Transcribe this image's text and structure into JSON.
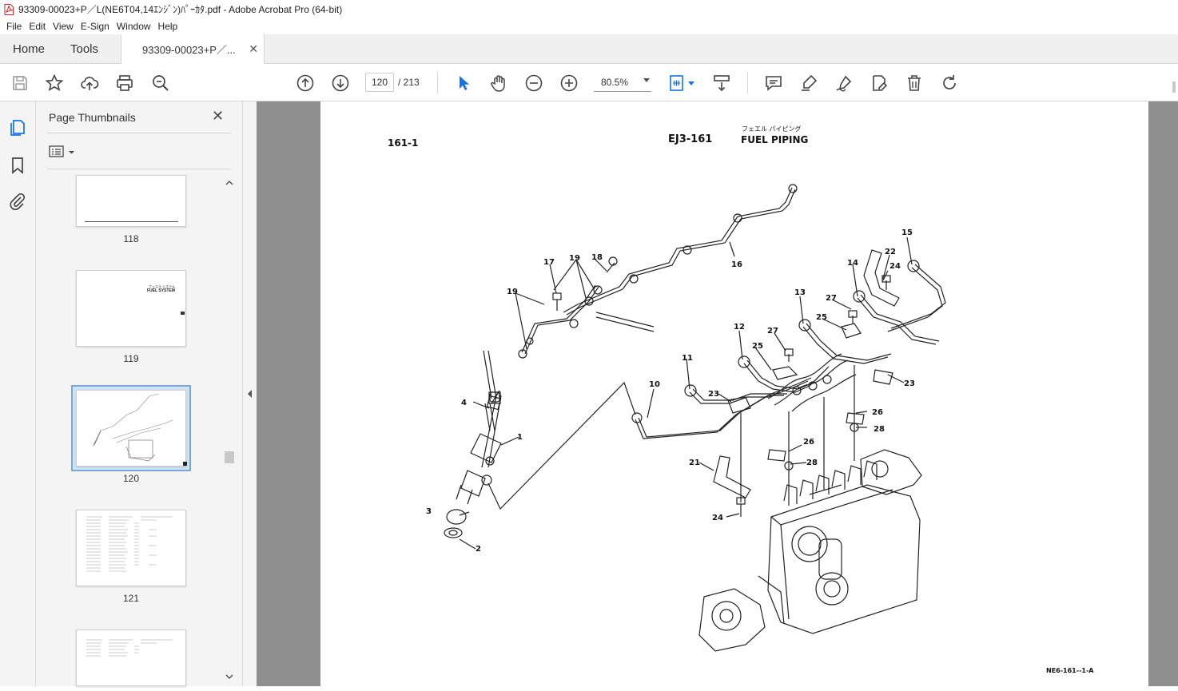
{
  "window": {
    "title": "93309-00023+P／L(NE6T04,14ｴﾝｼﾞﾝ)ﾊﾟｰｶﾀ.pdf - Adobe Acrobat Pro (64-bit)"
  },
  "menu": [
    "File",
    "Edit",
    "View",
    "E-Sign",
    "Window",
    "Help"
  ],
  "tabs": {
    "home": "Home",
    "tools": "Tools",
    "document": "93309-00023+P／..."
  },
  "toolbar": {
    "current_page": "120",
    "total_pages": "/  213",
    "zoom": "80.5%"
  },
  "panel": {
    "title": "Page Thumbnails",
    "thumbnails": [
      {
        "label": "118"
      },
      {
        "label": "119",
        "heading_jp": "フェエル システム",
        "heading": "FUEL SYSTEM"
      },
      {
        "label": "120"
      },
      {
        "label": "121"
      }
    ]
  },
  "page": {
    "ref": "161-1",
    "code": "EJ3-161",
    "title_jp": "フェエル パイピング",
    "title": "FUEL PIPING",
    "footer": "NE6-161--1-A",
    "callouts": [
      {
        "n": "1"
      },
      {
        "n": "2"
      },
      {
        "n": "3"
      },
      {
        "n": "4"
      },
      {
        "n": "10"
      },
      {
        "n": "11"
      },
      {
        "n": "12"
      },
      {
        "n": "13"
      },
      {
        "n": "14"
      },
      {
        "n": "15"
      },
      {
        "n": "16"
      },
      {
        "n": "17"
      },
      {
        "n": "18"
      },
      {
        "n": "19"
      },
      {
        "n": "19"
      },
      {
        "n": "21"
      },
      {
        "n": "22"
      },
      {
        "n": "23"
      },
      {
        "n": "23"
      },
      {
        "n": "24"
      },
      {
        "n": "24"
      },
      {
        "n": "25"
      },
      {
        "n": "25"
      },
      {
        "n": "26"
      },
      {
        "n": "26"
      },
      {
        "n": "27"
      },
      {
        "n": "27"
      },
      {
        "n": "28"
      },
      {
        "n": "28"
      }
    ]
  },
  "colors": {
    "accent": "#1473e6",
    "pdf_red": "#d4262c",
    "viewer_bg": "#8f8f8f"
  }
}
